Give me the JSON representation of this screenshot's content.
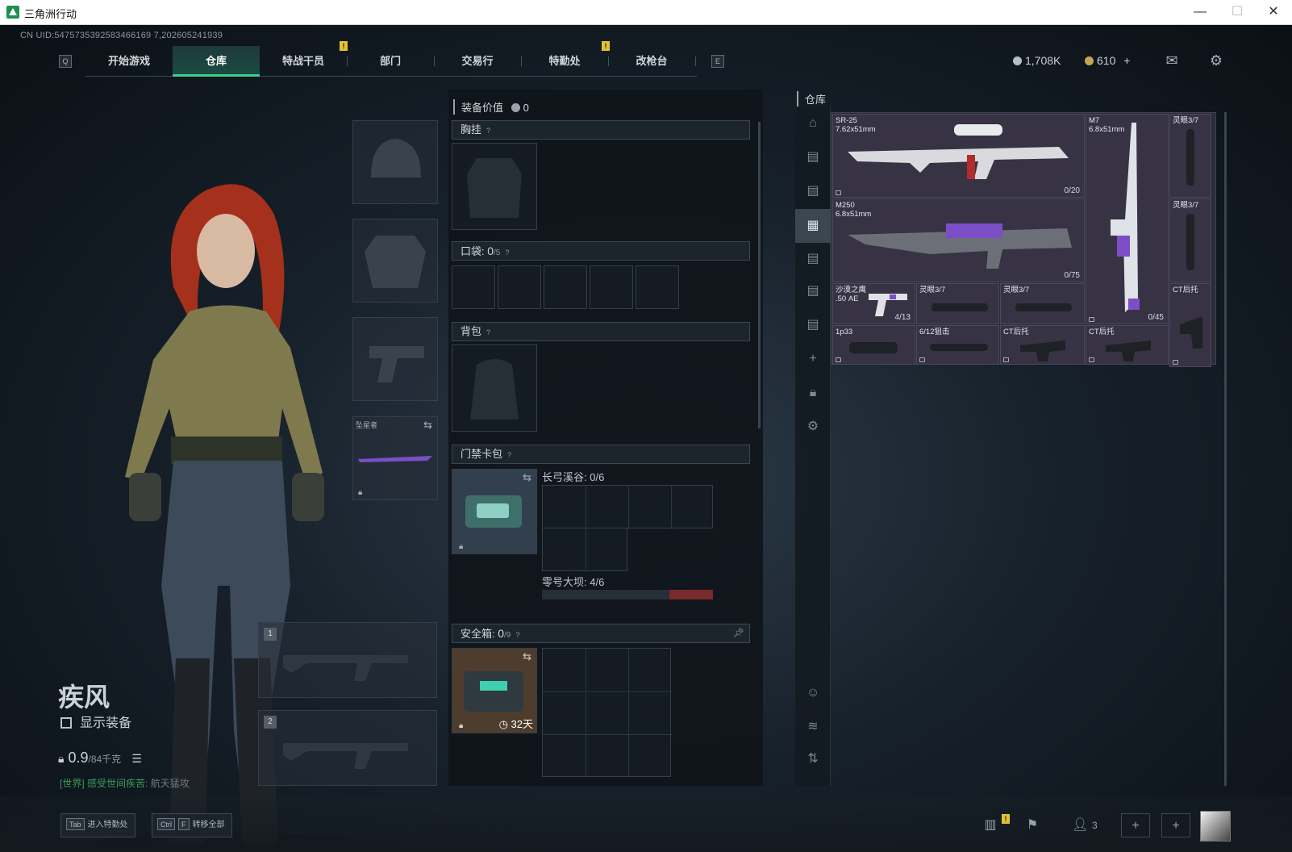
{
  "window": {
    "title": "三角洲行动",
    "minimize": "—",
    "maximize": "☐",
    "close": "✕"
  },
  "uid": "CN UID:5475735392583466169 7,202605241939",
  "nav": {
    "left_key": "Q",
    "right_key": "E",
    "tabs": [
      "开始游戏",
      "仓库",
      "特战干员",
      "部门",
      "交易行",
      "特勤处",
      "改枪台"
    ],
    "active_index": 1
  },
  "currency": {
    "silver": "1,708K",
    "gold": "610",
    "gold_plus": "+"
  },
  "character": {
    "name": "疾风",
    "show_equipment": "显示装备",
    "weight": "0.9",
    "weight_max": "/84千克",
    "chat_channel": "[世界]",
    "chat_name": "感受世间疾苦",
    "chat_message": "航天猛攻"
  },
  "weapon_slot_label": "坠星者",
  "weapon_slots": [
    "1",
    "2"
  ],
  "equipment": {
    "value_label": "装备价值",
    "value": "0",
    "chest_rig": "胸挂",
    "pockets": "口袋: ",
    "pockets_count": "0",
    "pockets_max": "/5",
    "backpack": "背包",
    "keycard": "门禁卡包",
    "key_area_1": "长弓溪谷: 0/6",
    "key_area_2": "零号大坝: 4/6",
    "safe_box": "安全箱: ",
    "safe_count": "0",
    "safe_max": "/9",
    "safe_timer": "32天",
    "help": "?"
  },
  "warehouse": {
    "title": "仓库",
    "items": [
      {
        "name": "SR-25\n7.62x51mm",
        "count": "0/20"
      },
      {
        "name": "M7\n6.8x51mm",
        "count": "0/45"
      },
      {
        "name": "灵眼3/7",
        "count": ""
      },
      {
        "name": "M250\n6.8x51mm",
        "count": "0/75"
      },
      {
        "name": "灵眼3/7",
        "count": ""
      },
      {
        "name": "沙漠之鹰\n.50 AE",
        "count": "4/13"
      },
      {
        "name": "灵眼3/7",
        "count": ""
      },
      {
        "name": "灵眼3/7",
        "count": ""
      },
      {
        "name": "CT后托",
        "count": ""
      },
      {
        "name": "1p33",
        "count": ""
      },
      {
        "name": "6/12狙击",
        "count": ""
      },
      {
        "name": "CT后托",
        "count": ""
      },
      {
        "name": "CT后托",
        "count": ""
      }
    ]
  },
  "bottom": {
    "tab_key": "Tab",
    "tab_label": "进入特勤处",
    "ctrl_key": "Ctrl",
    "f_key": "F",
    "transfer_label": "转移全部",
    "friends_count": "3",
    "plus": "+"
  },
  "colors": {
    "accent": "#3ecf8e",
    "alert": "#e5c232",
    "purple": "#7b4ec8"
  }
}
